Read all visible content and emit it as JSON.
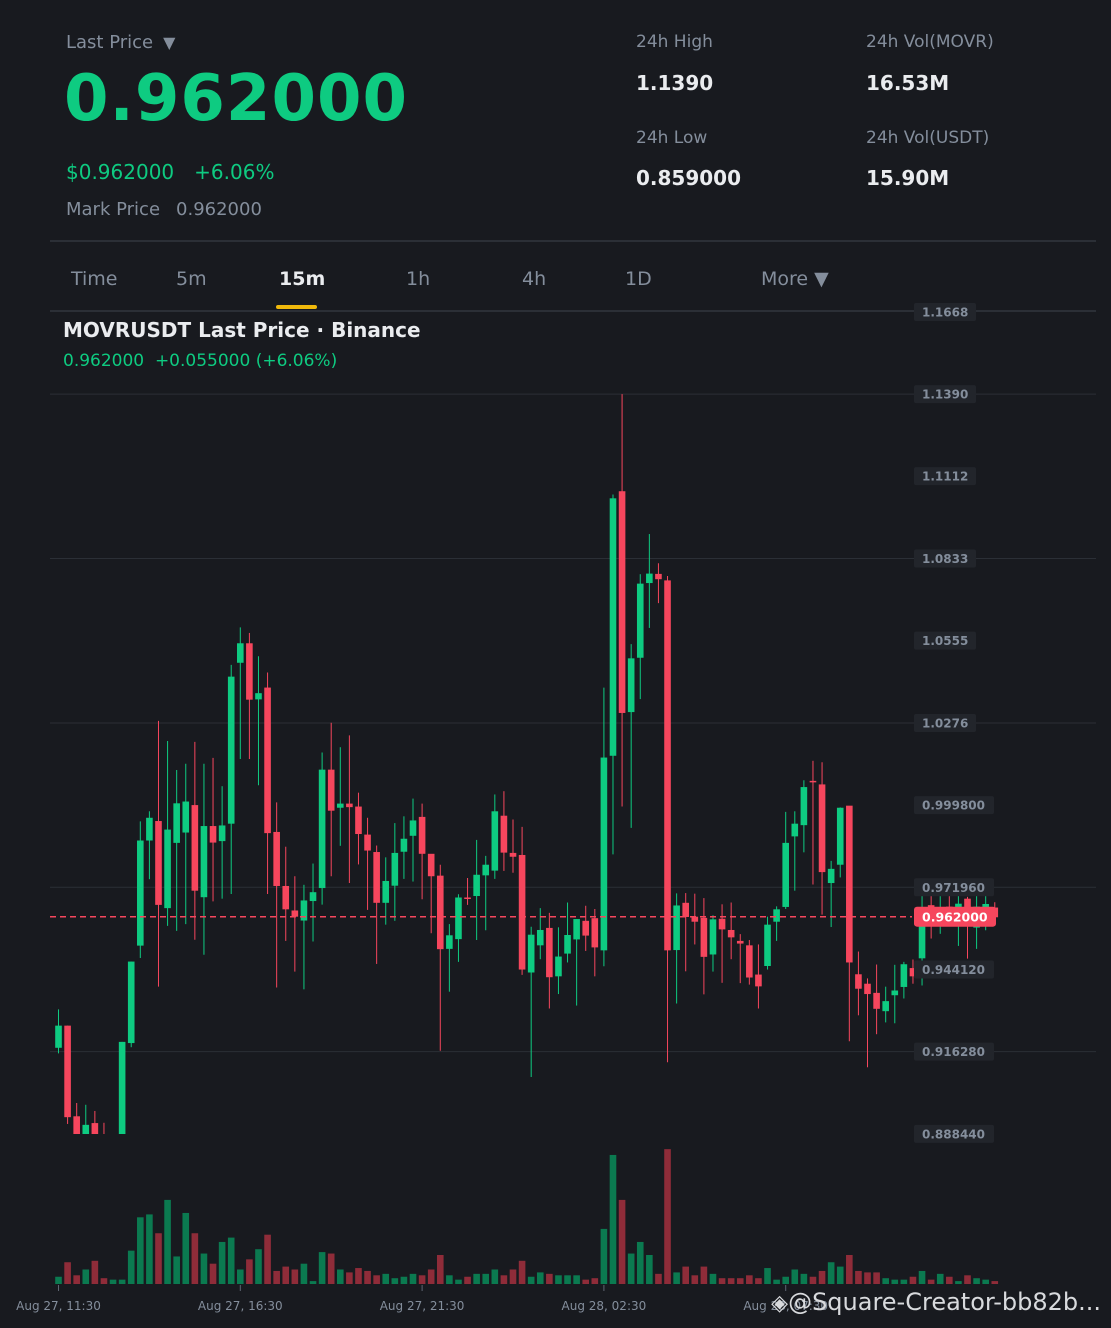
{
  "header": {
    "last_price_label": "Last Price",
    "last_price_caret": "▼",
    "last_price": "0.962000",
    "usd_price": "$0.962000",
    "change_pct": "+6.06%",
    "mark_price_label": "Mark Price",
    "mark_price": "0.962000"
  },
  "stats": {
    "high_label": "24h High",
    "high_value": "1.1390",
    "low_label": "24h Low",
    "low_value": "0.859000",
    "vol_base_label": "24h Vol(MOVR)",
    "vol_base_value": "16.53M",
    "vol_quote_label": "24h Vol(USDT)",
    "vol_quote_value": "15.90M"
  },
  "tabs": [
    {
      "label": "Time",
      "active": false
    },
    {
      "label": "5m",
      "active": false
    },
    {
      "label": "15m",
      "active": true
    },
    {
      "label": "1h",
      "active": false
    },
    {
      "label": "4h",
      "active": false
    },
    {
      "label": "1D",
      "active": false
    },
    {
      "label": "More ▼",
      "active": false
    }
  ],
  "chart_title": "MOVRUSDT Last Price · Binance",
  "chart_subtitle": {
    "price": "0.962000",
    "change": "+0.055000 (+6.06%)"
  },
  "watermark": "@Square-Creator-bb82b...",
  "colors": {
    "up": "#0ecb81",
    "down": "#f6465d",
    "vol_up": "#0b7a50",
    "vol_down": "#8f2c39",
    "accent": "#f0b90b"
  },
  "chart_data": {
    "type": "candlestick",
    "title": "MOVRUSDT Last Price · Binance",
    "interval": "15m",
    "ylim": [
      0.8884,
      1.1668
    ],
    "y_ticks": [
      "1.1668",
      "1.1390",
      "1.1112",
      "1.0833",
      "1.0555",
      "1.0276",
      "0.999800",
      "0.971960",
      "0.944120",
      "0.916280",
      "0.888440"
    ],
    "y_tick_values": [
      1.1668,
      1.139,
      1.1112,
      1.0833,
      1.0555,
      1.0276,
      0.9998,
      0.97196,
      0.94412,
      0.91628,
      0.88844
    ],
    "x_tick_labels": [
      "Aug 27, 11:30",
      "Aug 27, 16:30",
      "Aug 27, 21:30",
      "Aug 28, 02:30",
      "Aug 28, 07:30"
    ],
    "x_tick_indices": [
      0,
      20,
      40,
      60,
      80
    ],
    "current_price": 0.962,
    "current_price_label": "0.962000",
    "grid": true,
    "candles": [
      [
        0.9176,
        0.9251,
        0.9306,
        0.9157
      ],
      [
        0.9251,
        0.8941,
        0.9251,
        0.8918
      ],
      [
        0.8944,
        0.8856,
        0.8989,
        0.8771
      ],
      [
        0.8876,
        0.8915,
        0.8983,
        0.8856
      ],
      [
        0.8921,
        0.8855,
        0.8962,
        0.8747
      ],
      [
        0.8873,
        0.882,
        0.8922,
        0.876
      ],
      [
        0.8833,
        0.8837,
        0.886,
        0.8733
      ],
      [
        0.8854,
        0.9196,
        0.9196,
        0.885
      ],
      [
        0.9192,
        0.9468,
        0.9468,
        0.9178
      ],
      [
        0.9522,
        0.9878,
        0.9943,
        0.948
      ],
      [
        0.9878,
        0.9955,
        0.9977,
        0.9747
      ],
      [
        0.9944,
        0.966,
        1.0283,
        0.9383
      ],
      [
        0.9649,
        0.9915,
        1.0215,
        0.9589
      ],
      [
        0.987,
        1.0004,
        1.0117,
        0.9572
      ],
      [
        0.9905,
        1.001,
        1.0138,
        0.9595
      ],
      [
        0.9998,
        0.9708,
        1.0212,
        0.9542
      ],
      [
        0.9686,
        0.9927,
        1.0138,
        0.9491
      ],
      [
        0.9927,
        0.9871,
        1.0158,
        0.9672
      ],
      [
        0.9876,
        0.9929,
        1.0062,
        0.9681
      ],
      [
        0.9935,
        1.0433,
        1.0473,
        0.9697
      ],
      [
        1.048,
        1.0546,
        1.06,
        1.0154
      ],
      [
        1.0546,
        1.0355,
        1.0581,
        1.0154
      ],
      [
        1.0356,
        1.0377,
        1.0502,
        1.0065
      ],
      [
        1.0396,
        0.9903,
        1.0447,
        0.9697
      ],
      [
        0.9907,
        0.9724,
        1.0007,
        0.938
      ],
      [
        0.9724,
        0.9645,
        0.9857,
        0.9538
      ],
      [
        0.9641,
        0.962,
        0.9757,
        0.9434
      ],
      [
        0.9607,
        0.9675,
        0.9728,
        0.9374
      ],
      [
        0.9673,
        0.9703,
        0.98,
        0.9536
      ],
      [
        0.9717,
        1.0118,
        1.0176,
        0.9661
      ],
      [
        1.0118,
        0.9979,
        1.0277,
        0.9757
      ],
      [
        0.9989,
        1.0003,
        1.0194,
        0.986
      ],
      [
        1.0003,
        0.9991,
        1.0234,
        0.9734
      ],
      [
        0.9993,
        0.99,
        1.004,
        0.9797
      ],
      [
        0.9898,
        0.9844,
        0.9955,
        0.9643
      ],
      [
        0.9839,
        0.9667,
        0.9861,
        0.946
      ],
      [
        0.9667,
        0.9741,
        0.9821,
        0.9593
      ],
      [
        0.9725,
        0.9836,
        0.9937,
        0.9606
      ],
      [
        0.984,
        0.9884,
        0.996,
        0.9748
      ],
      [
        0.9894,
        0.9946,
        1.002,
        0.9739
      ],
      [
        0.9958,
        0.9833,
        1.0003,
        0.9679
      ],
      [
        0.9833,
        0.9757,
        0.9821,
        0.9564
      ],
      [
        0.9759,
        0.951,
        0.9796,
        0.9166
      ],
      [
        0.9511,
        0.9557,
        0.9595,
        0.9366
      ],
      [
        0.9544,
        0.9685,
        0.9696,
        0.9467
      ],
      [
        0.9685,
        0.9682,
        0.9751,
        0.966
      ],
      [
        0.969,
        0.9762,
        0.988,
        0.9541
      ],
      [
        0.976,
        0.9796,
        0.9826,
        0.9574
      ],
      [
        0.9776,
        0.9977,
        1.0034,
        0.9748
      ],
      [
        0.9962,
        0.9837,
        1.0045,
        0.9775
      ],
      [
        0.9836,
        0.9823,
        0.9949,
        0.9769
      ],
      [
        0.9829,
        0.9441,
        0.9924,
        0.9423
      ],
      [
        0.9431,
        0.9559,
        0.9586,
        0.9077
      ],
      [
        0.9523,
        0.9575,
        0.9649,
        0.9476
      ],
      [
        0.9582,
        0.9415,
        0.9633,
        0.9309
      ],
      [
        0.9418,
        0.9485,
        0.9584,
        0.9358
      ],
      [
        0.9495,
        0.9558,
        0.9668,
        0.9465
      ],
      [
        0.9543,
        0.9612,
        0.9612,
        0.9319
      ],
      [
        0.9606,
        0.9556,
        0.9657,
        0.9504
      ],
      [
        0.9615,
        0.9516,
        0.9646,
        0.9418
      ],
      [
        0.9506,
        1.0159,
        1.0396,
        0.9452
      ],
      [
        1.0165,
        1.1037,
        1.105,
        0.9831
      ],
      [
        1.1061,
        1.031,
        1.139,
        0.9993
      ],
      [
        1.0313,
        1.0495,
        1.0543,
        0.9921
      ],
      [
        1.0497,
        1.0748,
        1.078,
        1.0357
      ],
      [
        1.075,
        1.0782,
        1.0916,
        1.0598
      ],
      [
        1.0781,
        1.0763,
        1.0817,
        1.0682
      ],
      [
        1.0759,
        0.9506,
        1.0774,
        0.9127
      ],
      [
        0.9507,
        0.9658,
        0.9699,
        0.9326
      ],
      [
        0.9667,
        0.9619,
        0.97,
        0.9435
      ],
      [
        0.962,
        0.9603,
        0.9698,
        0.9526
      ],
      [
        0.9616,
        0.9484,
        0.9683,
        0.9357
      ],
      [
        0.9492,
        0.9611,
        0.9625,
        0.9434
      ],
      [
        0.9613,
        0.9577,
        0.9662,
        0.9396
      ],
      [
        0.9575,
        0.955,
        0.9668,
        0.9476
      ],
      [
        0.9538,
        0.9529,
        0.9561,
        0.9395
      ],
      [
        0.9523,
        0.9414,
        0.9541,
        0.939
      ],
      [
        0.9424,
        0.9384,
        0.9526,
        0.9309
      ],
      [
        0.9453,
        0.9593,
        0.962,
        0.9441
      ],
      [
        0.9603,
        0.9645,
        0.9655,
        0.9538
      ],
      [
        0.9653,
        0.987,
        0.9975,
        0.9646
      ],
      [
        0.9892,
        0.9935,
        0.9977,
        0.9708
      ],
      [
        0.993,
        1.0059,
        1.0082,
        0.9838
      ],
      [
        1.008,
        1.0078,
        1.0148,
        0.9729
      ],
      [
        1.0068,
        0.9771,
        1.0143,
        0.9627
      ],
      [
        0.9734,
        0.9782,
        0.9809,
        0.9585
      ],
      [
        0.9796,
        0.9989,
        0.999,
        0.9753
      ],
      [
        0.9996,
        0.9465,
        0.9995,
        0.9198
      ],
      [
        0.9425,
        0.9376,
        0.9502,
        0.9286
      ],
      [
        0.9393,
        0.9358,
        0.9411,
        0.911
      ],
      [
        0.9362,
        0.9308,
        0.9458,
        0.9222
      ],
      [
        0.93,
        0.9334,
        0.9383,
        0.9262
      ],
      [
        0.9354,
        0.937,
        0.9457,
        0.9259
      ],
      [
        0.9382,
        0.9459,
        0.9467,
        0.9343
      ],
      [
        0.9446,
        0.9418,
        0.9475,
        0.9393
      ],
      [
        0.9479,
        0.9642,
        0.9728,
        0.9387
      ],
      [
        0.9659,
        0.9606,
        0.9742,
        0.9546
      ],
      [
        0.9614,
        0.9645,
        0.969,
        0.9562
      ],
      [
        0.9654,
        0.9623,
        0.9717,
        0.9594
      ],
      [
        0.9606,
        0.9664,
        0.9701,
        0.9521
      ],
      [
        0.9681,
        0.9597,
        0.9687,
        0.9478
      ],
      [
        0.9583,
        0.9654,
        0.9724,
        0.9511
      ],
      [
        0.9637,
        0.9663,
        0.9744,
        0.9574
      ],
      [
        0.9651,
        0.9618,
        0.9669,
        0.9627
      ]
    ],
    "volumes": [
      0.05,
      0.15,
      0.06,
      0.1,
      0.16,
      0.04,
      0.03,
      0.03,
      0.23,
      0.46,
      0.48,
      0.35,
      0.58,
      0.19,
      0.49,
      0.35,
      0.21,
      0.14,
      0.29,
      0.32,
      0.1,
      0.17,
      0.24,
      0.34,
      0.09,
      0.12,
      0.1,
      0.14,
      0.02,
      0.22,
      0.21,
      0.1,
      0.08,
      0.11,
      0.09,
      0.06,
      0.07,
      0.04,
      0.05,
      0.07,
      0.06,
      0.1,
      0.2,
      0.06,
      0.03,
      0.05,
      0.07,
      0.07,
      0.1,
      0.06,
      0.1,
      0.16,
      0.05,
      0.08,
      0.07,
      0.06,
      0.06,
      0.06,
      0.03,
      0.04,
      0.38,
      0.89,
      0.58,
      0.21,
      0.29,
      0.2,
      0.07,
      0.93,
      0.08,
      0.12,
      0.06,
      0.12,
      0.07,
      0.04,
      0.04,
      0.04,
      0.06,
      0.04,
      0.11,
      0.03,
      0.05,
      0.1,
      0.07,
      0.05,
      0.09,
      0.15,
      0.12,
      0.2,
      0.09,
      0.08,
      0.08,
      0.04,
      0.03,
      0.03,
      0.05,
      0.09,
      0.03,
      0.07,
      0.05,
      0.02,
      0.06,
      0.04,
      0.03,
      0.02
    ]
  }
}
